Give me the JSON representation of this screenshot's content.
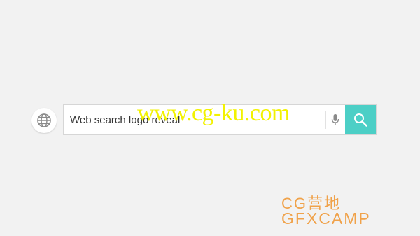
{
  "search": {
    "value": "Web search logo reveal"
  },
  "icons": {
    "globe": "globe-icon",
    "mic": "microphone-icon",
    "search": "search-icon"
  },
  "colors": {
    "background": "#f2f2f2",
    "search_button": "#4ccfc6",
    "watermark_yellow": "#f2f200",
    "logo_orange": "#f0a24a",
    "icon_gray": "#8a8a8a"
  },
  "watermark": {
    "url": "www.cg-ku.com"
  },
  "logo": {
    "line1": "CG营地",
    "line2": "GFXCAMP"
  }
}
